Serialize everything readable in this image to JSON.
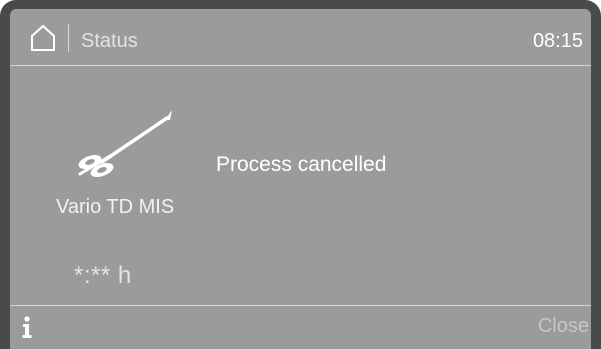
{
  "header": {
    "home_icon": "home-icon",
    "title": "Status",
    "time": "08:15"
  },
  "main": {
    "instrument_icon": "surgical-instrument-icon",
    "program_name": "Vario TD MIS",
    "message": "Process cancelled",
    "remaining_time": "*:** h"
  },
  "footer": {
    "info_icon": "info-icon",
    "close_label": "Close"
  },
  "colors": {
    "background": "#9b9b9b",
    "bezel": "#4a4a4a",
    "text": "#ffffff",
    "divider": "#d6d6d6"
  }
}
